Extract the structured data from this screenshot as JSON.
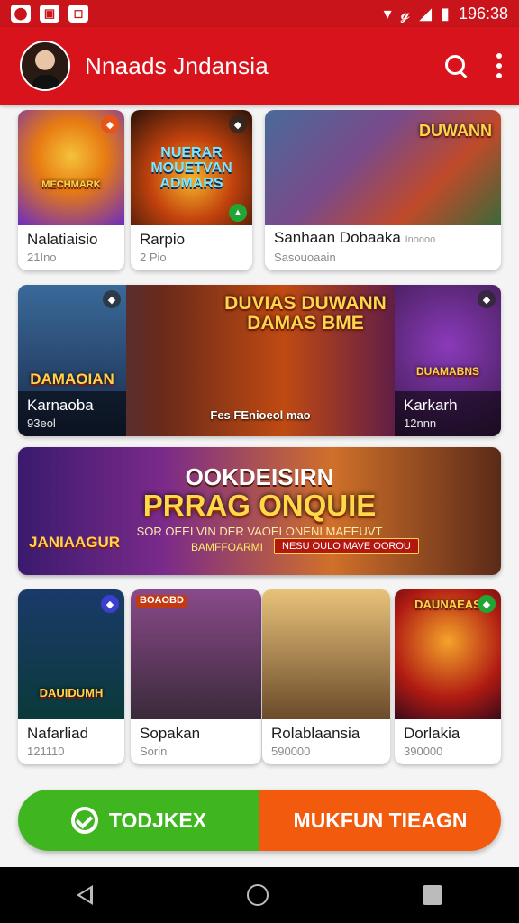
{
  "status": {
    "time": "196:38",
    "signal": "𝓰"
  },
  "appbar": {
    "title": "Nnaads Jndansia"
  },
  "row1": [
    {
      "title": "Nalatiaisio",
      "sub": "21Ino",
      "art": "MECHMARK",
      "badge": "◆"
    },
    {
      "title": "Rarpio",
      "sub": "2 Pio",
      "art": "NUERAR MOUETVAN ADMARS",
      "badge": "◆",
      "badge2": "▲"
    },
    {
      "title": "Sanhaan Dobaaka",
      "sub": "Sasouoaain",
      "meta": "Inoooo",
      "art": "DUWANN"
    }
  ],
  "row2": [
    {
      "title": "Karnaoba",
      "sub": "93eol",
      "art": "DAMAOIAN",
      "badge": "◆"
    },
    {
      "art": "DUVIAS DUWANN DAMAS BME",
      "caption": "Fes FEnioeol mao"
    },
    {
      "title": "Karkarh",
      "sub": "12nnn",
      "art": "DUAMABNS",
      "badge": "◆"
    }
  ],
  "banner": {
    "line1": "OOKDEISIRN",
    "line2": "PRRAG ONQUIE",
    "line3": "SOR OEEI VIN DER VAOEI ONENI MAEEUVT",
    "promo": "BAMFFOARMI",
    "promo_btn": "NESU OULO MAVE OOROU",
    "logo": "JANIAAGUR"
  },
  "row3": [
    {
      "title": "Nafarliad",
      "sub": "121110",
      "art": "DAUIDUMH",
      "badge": "◆"
    },
    {
      "title": "Sopakan",
      "sub": "Sorin",
      "art": "BOAOBD"
    },
    {
      "title": "Rolablaansia",
      "sub": "590000",
      "art": ""
    },
    {
      "title": "Dorlakia",
      "sub": "390000",
      "art": "DAUNAEAS",
      "badge": "◆"
    }
  ],
  "cta": {
    "left": "TODJKEX",
    "right": "MUKFUN TIEAGN"
  }
}
